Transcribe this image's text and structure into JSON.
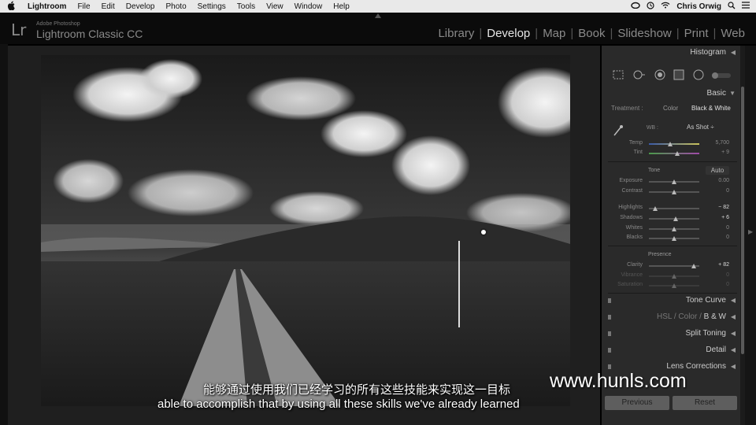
{
  "menubar": {
    "apple": "",
    "app": "Lightroom",
    "items": [
      "File",
      "Edit",
      "Develop",
      "Photo",
      "Settings",
      "Tools",
      "View",
      "Window",
      "Help"
    ],
    "user": "Chris Orwig"
  },
  "identity": {
    "logo": "Lr",
    "sub": "Adobe Photoshop",
    "name": "Lightroom Classic CC"
  },
  "modules": [
    "Library",
    "Develop",
    "Map",
    "Book",
    "Slideshow",
    "Print",
    "Web"
  ],
  "active_module": "Develop",
  "panel": {
    "histogram": "Histogram",
    "basic": "Basic",
    "treatment_label": "Treatment :",
    "treatment_color": "Color",
    "treatment_bw": "Black & White",
    "wb_label": "WB :",
    "wb_value": "As Shot ÷",
    "temp_label": "Temp",
    "temp_value": "5,700",
    "tint_label": "Tint",
    "tint_value": "+ 9",
    "tone": "Tone",
    "auto": "Auto",
    "exposure_label": "Exposure",
    "exposure_value": "0.00",
    "contrast_label": "Contrast",
    "contrast_value": "0",
    "highlights_label": "Highlights",
    "highlights_value": "− 82",
    "shadows_label": "Shadows",
    "shadows_value": "+ 6",
    "whites_label": "Whites",
    "whites_value": "0",
    "blacks_label": "Blacks",
    "blacks_value": "0",
    "presence": "Presence",
    "clarity_label": "Clarity",
    "clarity_value": "+ 82",
    "vibrance_label": "Vibrance",
    "vibrance_value": "0",
    "saturation_label": "Saturation",
    "saturation_value": "0",
    "tone_curve": "Tone Curve",
    "hsl": "HSL",
    "color": "Color",
    "bw": "B & W",
    "split_toning": "Split Toning",
    "detail": "Detail",
    "lens_corrections": "Lens Corrections",
    "previous": "Previous",
    "reset": "Reset"
  },
  "subtitles": {
    "cn": "能够通过使用我们已经学习的所有这些技能来实现这一目标",
    "en": "able to accomplish that by using all these skills we've already learned"
  },
  "watermark": "www.hunls.com",
  "colors": {
    "panel": "#2a2a2a",
    "workspace": "#1f1f1f",
    "active_module": "#e6e6e6"
  }
}
